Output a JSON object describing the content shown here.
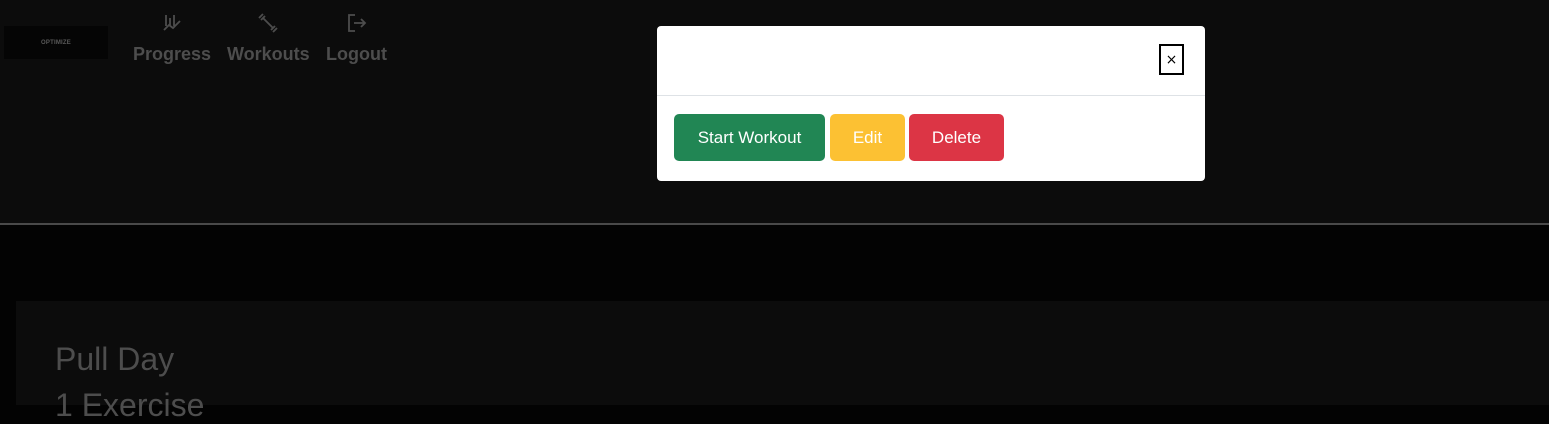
{
  "header": {
    "logo_text": "OPTIMIZE",
    "nav": [
      {
        "label": "Progress",
        "icon": "chart-icon"
      },
      {
        "label": "Workouts",
        "icon": "dumbbell-icon"
      },
      {
        "label": "Logout",
        "icon": "logout-icon"
      }
    ]
  },
  "card": {
    "title": "Pull Day",
    "subtitle": "1 Exercise"
  },
  "modal": {
    "close_label": "×",
    "buttons": {
      "start": "Start Workout",
      "edit": "Edit",
      "delete": "Delete"
    }
  },
  "colors": {
    "start": "#218654",
    "edit": "#fcc133",
    "delete": "#dc3545",
    "header_bg": "#0c0c0c",
    "page_bg": "#030303"
  }
}
